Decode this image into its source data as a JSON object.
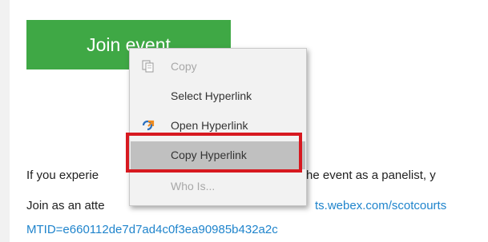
{
  "join_button": {
    "label": "Join event"
  },
  "body": {
    "experience_text_start": "If you experie",
    "experience_text_end": "he event as a panelist, y",
    "attendee_prefix": "Join as an atte",
    "attendee_link": "ts.webex.com/scotcourts",
    "meeting_id_line": "MTID=e660112de7d7ad4c0f3ea90985b432a2c"
  },
  "context_menu": {
    "items": [
      {
        "label": "Copy",
        "icon": "copy-icon",
        "disabled": true
      },
      {
        "label": "Select Hyperlink",
        "icon": "",
        "disabled": false
      },
      {
        "label": "Open Hyperlink",
        "icon": "open-hyperlink-icon",
        "disabled": false
      },
      {
        "label": "Copy Hyperlink",
        "icon": "",
        "disabled": false,
        "highlighted": true
      },
      {
        "label": "Who Is...",
        "icon": "",
        "disabled": true
      }
    ]
  },
  "colors": {
    "join_button": "#3fa845",
    "link": "#1f84cc",
    "highlight_border": "#d71920"
  }
}
